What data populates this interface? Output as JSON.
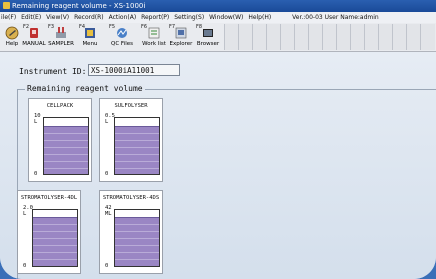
{
  "window": {
    "title": "Remaining reagent volume - XS-1000i"
  },
  "menu": {
    "items": [
      "ile(F)",
      "Edit(E)",
      "View(V)",
      "Record(R)",
      "Action(A)",
      "Report(P)",
      "Setting(S)",
      "Window(W)",
      "Help(H)"
    ],
    "version_user": "Ver.:00-03 User Name:admin"
  },
  "toolbar": {
    "buttons": [
      {
        "fkey": "",
        "label": "Help",
        "icon": "help-icon"
      },
      {
        "fkey": "F2",
        "label": "MANUAL",
        "icon": "manual-analysis-icon"
      },
      {
        "fkey": "F3",
        "label": "SAMPLER",
        "icon": "sampler-icon"
      },
      {
        "fkey": "F4",
        "label": "Menu",
        "icon": "menu-icon"
      },
      {
        "fkey": "F5",
        "label": "QC Files",
        "icon": "qc-files-icon"
      },
      {
        "fkey": "F6",
        "label": "Work list",
        "icon": "work-list-icon"
      },
      {
        "fkey": "F7",
        "label": "Explorer",
        "icon": "explorer-icon"
      },
      {
        "fkey": "F8",
        "label": "Browser",
        "icon": "browser-icon"
      }
    ]
  },
  "instrument": {
    "label": "Instrument ID:",
    "value": "XS-1000iA11001"
  },
  "group": {
    "title": "Remaining reagent volume"
  },
  "reagents": [
    {
      "name": "CELLPACK",
      "max": "10",
      "unit": "L",
      "zero": "0",
      "level": 0.85
    },
    {
      "name": "SULFOLYSER",
      "max": "0.5",
      "unit": "L",
      "zero": "0",
      "level": 0.85
    },
    {
      "name": "STROMATOLYSER-4DL",
      "max": "2.0",
      "unit": "L",
      "zero": "0",
      "level": 0.88
    },
    {
      "name": "STROMATOLYSER-4DS",
      "max": "42",
      "unit": "ML",
      "zero": "0",
      "level": 0.88
    }
  ]
}
